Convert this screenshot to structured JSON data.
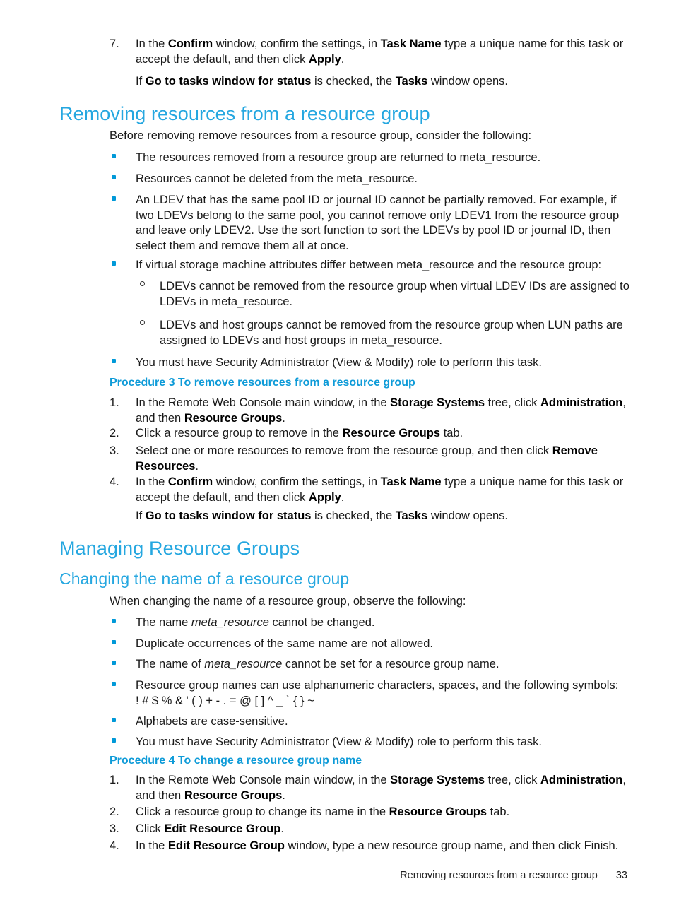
{
  "page": {
    "number": "33",
    "footer_title": "Removing resources from a resource group"
  },
  "top_step": {
    "number": "7.",
    "line1_a": "In the ",
    "line1_b": "Confirm",
    "line1_c": " window, confirm the settings, in ",
    "line1_d": "Task Name",
    "line1_e": " type a unique name for this task or accept the default, and then click ",
    "line1_f": "Apply",
    "line1_g": ".",
    "line2_a": "If ",
    "line2_b": "Go to tasks window for status",
    "line2_c": " is checked, the ",
    "line2_d": "Tasks",
    "line2_e": " window opens."
  },
  "section_removing": {
    "title": "Removing resources from a resource group",
    "intro": "Before removing remove resources from a resource group, consider the following:",
    "bullets": [
      "The resources removed from a resource group are returned to meta_resource.",
      "Resources cannot be deleted from the meta_resource.",
      "An LDEV that has the same pool ID or journal ID cannot be partially removed. For example, if two LDEVs belong to the same pool, you cannot remove only LDEV1 from the resource group and leave only LDEV2. Use the sort function to sort the LDEVs by pool ID or journal ID, then select them and remove them all at once.",
      "If virtual storage machine attributes differ between meta_resource and the resource group:"
    ],
    "sub_bullets": [
      "LDEVs cannot be removed from the resource group when virtual LDEV IDs are assigned to LDEVs in meta_resource.",
      "LDEVs and host groups cannot be removed from the resource group when LUN paths are assigned to LDEVs and host groups in meta_resource."
    ],
    "bullet_last": "You must have Security Administrator (View & Modify) role to perform this task.",
    "procedure_title": "Procedure 3 To remove resources from a resource group",
    "steps": [
      {
        "number": "1.",
        "a": "In the Remote Web Console main window, in the ",
        "b": "Storage Systems",
        "c": " tree, click ",
        "d": "Administration",
        "e": ", and then ",
        "f": "Resource Groups",
        "g": "."
      },
      {
        "number": "2.",
        "a": "Click a resource group to remove in the ",
        "b": "Resource Groups",
        "c": " tab."
      },
      {
        "number": "3.",
        "a": "Select one or more resources to remove from the resource group, and then click ",
        "b": "Remove Resources",
        "c": "."
      },
      {
        "number": "4.",
        "a": "In the ",
        "b": "Confirm",
        "c": " window, confirm the settings, in ",
        "d": "Task Name",
        "e": " type a unique name for this task or accept the default, and then click ",
        "f": "Apply",
        "g": "."
      }
    ],
    "step4_note": {
      "a": "If ",
      "b": "Go to tasks window for status",
      "c": " is checked, the ",
      "d": "Tasks",
      "e": " window opens."
    }
  },
  "section_managing": {
    "title": "Managing Resource Groups",
    "sub_title": "Changing the name of a resource group",
    "intro": "When changing the name of a resource group, observe the following:",
    "bullet1": {
      "a": "The name ",
      "b": "meta_resource",
      "c": " cannot be changed."
    },
    "bullet2": "Duplicate occurrences of the same name are not allowed.",
    "bullet3": {
      "a": "The name of ",
      "b": "meta_resource",
      "c": " cannot be set for a resource group name."
    },
    "bullet4": {
      "line1": "Resource group names can use alphanumeric characters, spaces, and the following symbols:",
      "line2": "! # $ % & ' ( ) + - . = @ [ ] ^ _ ` { } ~"
    },
    "bullet5": "Alphabets are case-sensitive.",
    "bullet6": "You must have Security Administrator (View & Modify) role to perform this task.",
    "procedure_title": "Procedure 4 To change a resource group name",
    "steps": [
      {
        "number": "1.",
        "a": "In the Remote Web Console main window, in the ",
        "b": "Storage Systems",
        "c": " tree, click ",
        "d": "Administration",
        "e": ", and then ",
        "f": "Resource Groups",
        "g": "."
      },
      {
        "number": "2.",
        "a": "Click a resource group to change its name in the ",
        "b": "Resource Groups",
        "c": " tab."
      },
      {
        "number": "3.",
        "a": "Click ",
        "b": "Edit Resource Group",
        "c": "."
      },
      {
        "number": "4.",
        "a": "In the ",
        "b": "Edit Resource Group",
        "c": " window, type a new resource group name, and then click Finish."
      }
    ]
  },
  "colors": {
    "heading_blue": "#25A7E0",
    "procedure_blue": "#0E9BD8",
    "bullet_blue": "#0099D8"
  }
}
